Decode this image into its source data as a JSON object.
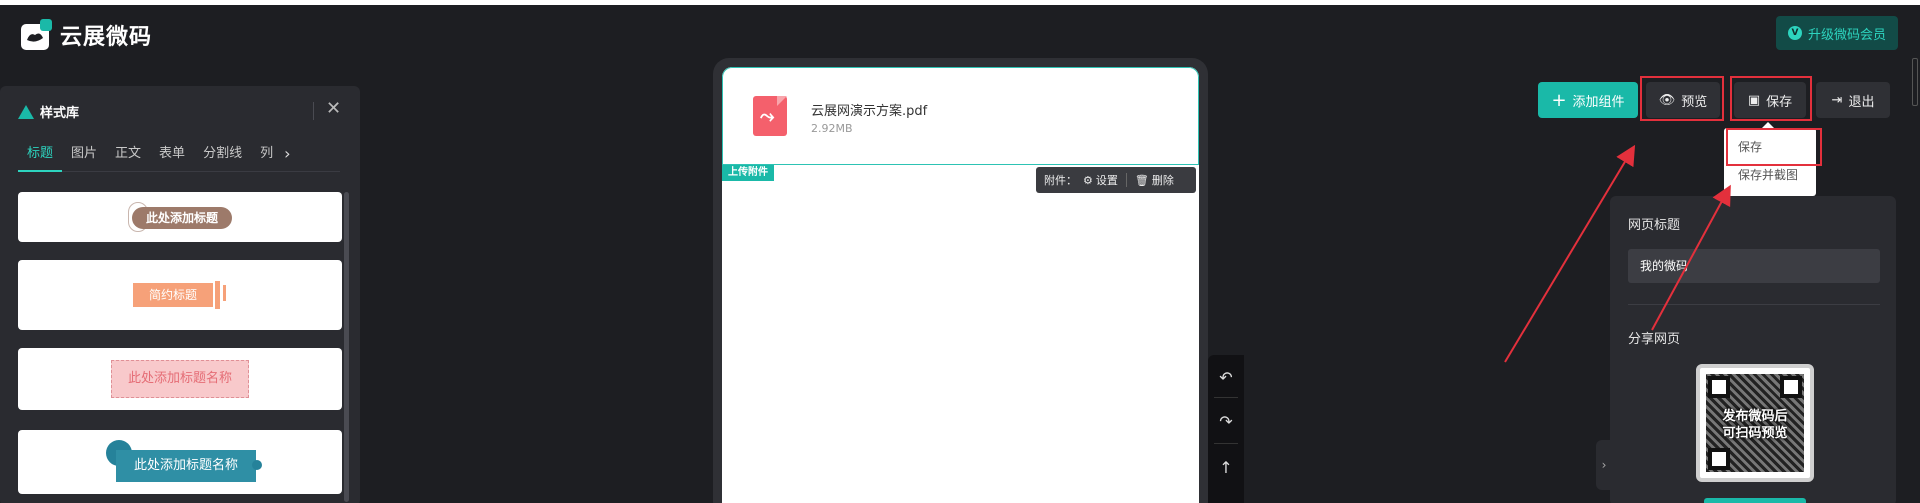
{
  "app": {
    "logo_text": "云展微码",
    "upgrade_label": "升级微码会员"
  },
  "left_panel": {
    "title": "样式库",
    "tabs": [
      "标题",
      "图片",
      "正文",
      "表单",
      "分割线",
      "列"
    ],
    "active_tab": "标题",
    "cards": [
      "此处添加标题",
      "简约标题",
      "此处添加标题名称",
      "此处添加标题名称"
    ]
  },
  "canvas": {
    "file_name": "云展网演示方案.pdf",
    "file_size": "2.92MB",
    "upload_tag": "上传附件",
    "toolbar": {
      "label": "附件：",
      "settings": "设置",
      "delete": "删除"
    }
  },
  "toolbar": {
    "add_component": "添加组件",
    "preview": "预览",
    "save": "保存",
    "exit": "退出"
  },
  "save_menu": [
    "保存",
    "保存并截图"
  ],
  "settings": {
    "page_title_label": "网页标题",
    "page_title_value": "我的微码",
    "share_label": "分享网页",
    "qr_text_line1": "发布微码后",
    "qr_text_line2": "可扫码预览"
  },
  "colors": {
    "accent": "#1ab9a8",
    "highlight": "#e3303c",
    "bg": "#1d1e22"
  },
  "icons": [
    "undo-icon",
    "redo-icon",
    "up-arrow-icon",
    "eye-icon",
    "save-icon",
    "exit-icon",
    "plus-icon",
    "pdf-icon"
  ]
}
